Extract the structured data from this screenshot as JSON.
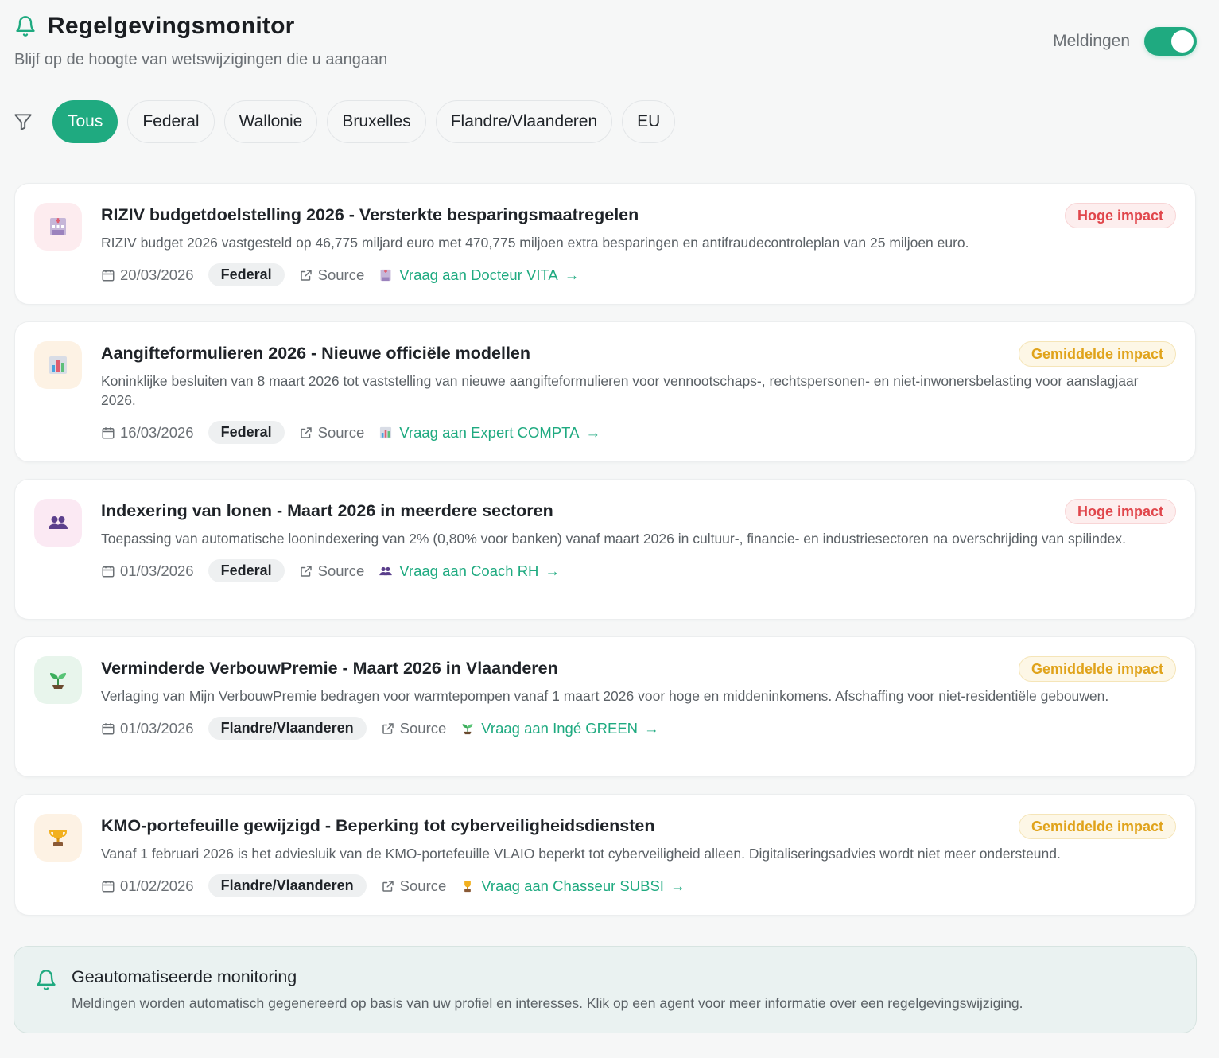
{
  "header": {
    "title": "Regelgevingsmonitor",
    "subtitle": "Blijf op de hoogte van wetswijzigingen die u aangaan",
    "notifications_label": "Meldingen",
    "notifications_enabled": true,
    "accent_color": "#1faa80"
  },
  "filters": [
    {
      "label": "Tous",
      "active": true
    },
    {
      "label": "Federal",
      "active": false
    },
    {
      "label": "Wallonie",
      "active": false
    },
    {
      "label": "Bruxelles",
      "active": false
    },
    {
      "label": "Flandre/Vlaanderen",
      "active": false
    },
    {
      "label": "EU",
      "active": false
    }
  ],
  "items": [
    {
      "icon": "hospital-icon",
      "title": "RIZIV budgetdoelstelling 2026 - Versterkte besparingsmaatregelen",
      "description": "RIZIV budget 2026 vastgesteld op 46,775 miljard euro met 470,775 miljoen extra besparingen en antifraudecontroleplan van 25 miljoen euro.",
      "date": "20/03/2026",
      "region": "Federal",
      "source_label": "Source",
      "ask_label": "Vraag aan Docteur VITA",
      "impact": "Hoge impact",
      "impact_level": "high"
    },
    {
      "icon": "bar-chart-icon",
      "title": "Aangifteformulieren 2026 - Nieuwe officiële modellen",
      "description": "Koninklijke besluiten van 8 maart 2026 tot vaststelling van nieuwe aangifteformulieren voor vennootschaps-, rechtspersonen- en niet-inwonersbelasting voor aanslagjaar 2026.",
      "date": "16/03/2026",
      "region": "Federal",
      "source_label": "Source",
      "ask_label": "Vraag aan Expert COMPTA",
      "impact": "Gemiddelde impact",
      "impact_level": "medium"
    },
    {
      "icon": "people-icon",
      "title": "Indexering van lonen - Maart 2026 in meerdere sectoren",
      "description": "Toepassing van automatische loonindexering van 2% (0,80% voor banken) vanaf maart 2026 in cultuur-, financie- en industriesectoren na overschrijding van spilindex.",
      "date": "01/03/2026",
      "region": "Federal",
      "source_label": "Source",
      "ask_label": "Vraag aan Coach RH",
      "impact": "Hoge impact",
      "impact_level": "high"
    },
    {
      "icon": "seedling-icon",
      "title": "Verminderde VerbouwPremie - Maart 2026 in Vlaanderen",
      "description": "Verlaging van Mijn VerbouwPremie bedragen voor warmtepompen vanaf 1 maart 2026 voor hoge en middeninkomens. Afschaffing voor niet-residentiële gebouwen.",
      "date": "01/03/2026",
      "region": "Flandre/Vlaanderen",
      "source_label": "Source",
      "ask_label": "Vraag aan Ingé GREEN",
      "impact": "Gemiddelde impact",
      "impact_level": "medium"
    },
    {
      "icon": "trophy-icon",
      "title": "KMO-portefeuille gewijzigd - Beperking tot cyberveiligheidsdiensten",
      "description": "Vanaf 1 februari 2026 is het adviesluik van de KMO-portefeuille VLAIO beperkt tot cyberveiligheid alleen. Digitaliseringsadvies wordt niet meer ondersteund.",
      "date": "01/02/2026",
      "region": "Flandre/Vlaanderen",
      "source_label": "Source",
      "ask_label": "Vraag aan Chasseur SUBSI",
      "impact": "Gemiddelde impact",
      "impact_level": "medium"
    }
  ],
  "info": {
    "title": "Geautomatiseerde monitoring",
    "text": "Meldingen worden automatisch gegenereerd op basis van uw profiel en interesses. Klik op een agent voor meer informatie over een regelgevingswijziging."
  }
}
